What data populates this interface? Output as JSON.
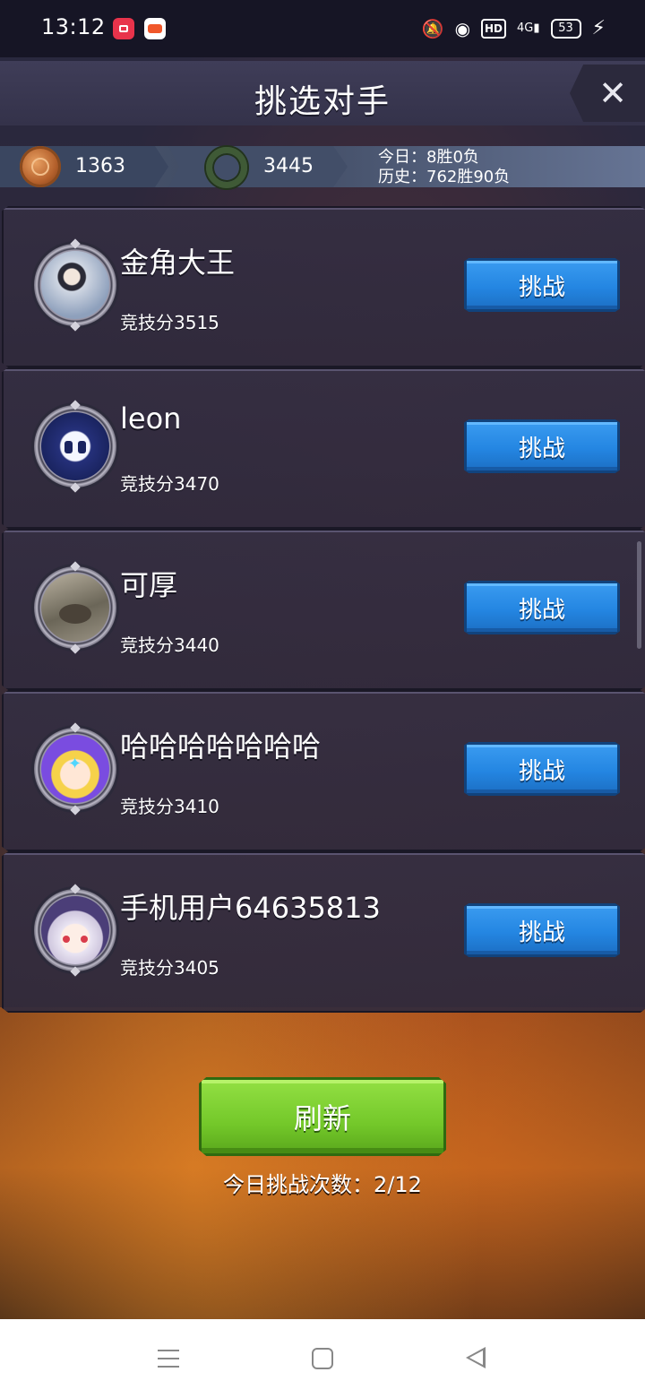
{
  "status_bar": {
    "time": "13:12",
    "hd": "HD",
    "network": "4G",
    "battery": "53"
  },
  "header": {
    "title": "挑选对手",
    "close_label": "✕"
  },
  "resources": {
    "coins": "1363",
    "trophies": "3445",
    "today_record": "今日：8胜0负",
    "history_record": "历史：762胜90负"
  },
  "opponents": [
    {
      "name": "金角大王",
      "score": "竞技分3515",
      "button": "挑战"
    },
    {
      "name": "leon",
      "score": "竞技分3470",
      "button": "挑战"
    },
    {
      "name": "可厚",
      "score": "竞技分3440",
      "button": "挑战"
    },
    {
      "name": "哈哈哈哈哈哈哈",
      "score": "竞技分3410",
      "button": "挑战"
    },
    {
      "name": "手机用户64635813",
      "score": "竞技分3405",
      "button": "挑战"
    }
  ],
  "footer": {
    "refresh_label": "刷新",
    "challenge_count": "今日挑战次数：2/12"
  },
  "colors": {
    "challenge_button": "#2486e2",
    "refresh_button": "#74c82a",
    "card_bg": "#342e42"
  }
}
